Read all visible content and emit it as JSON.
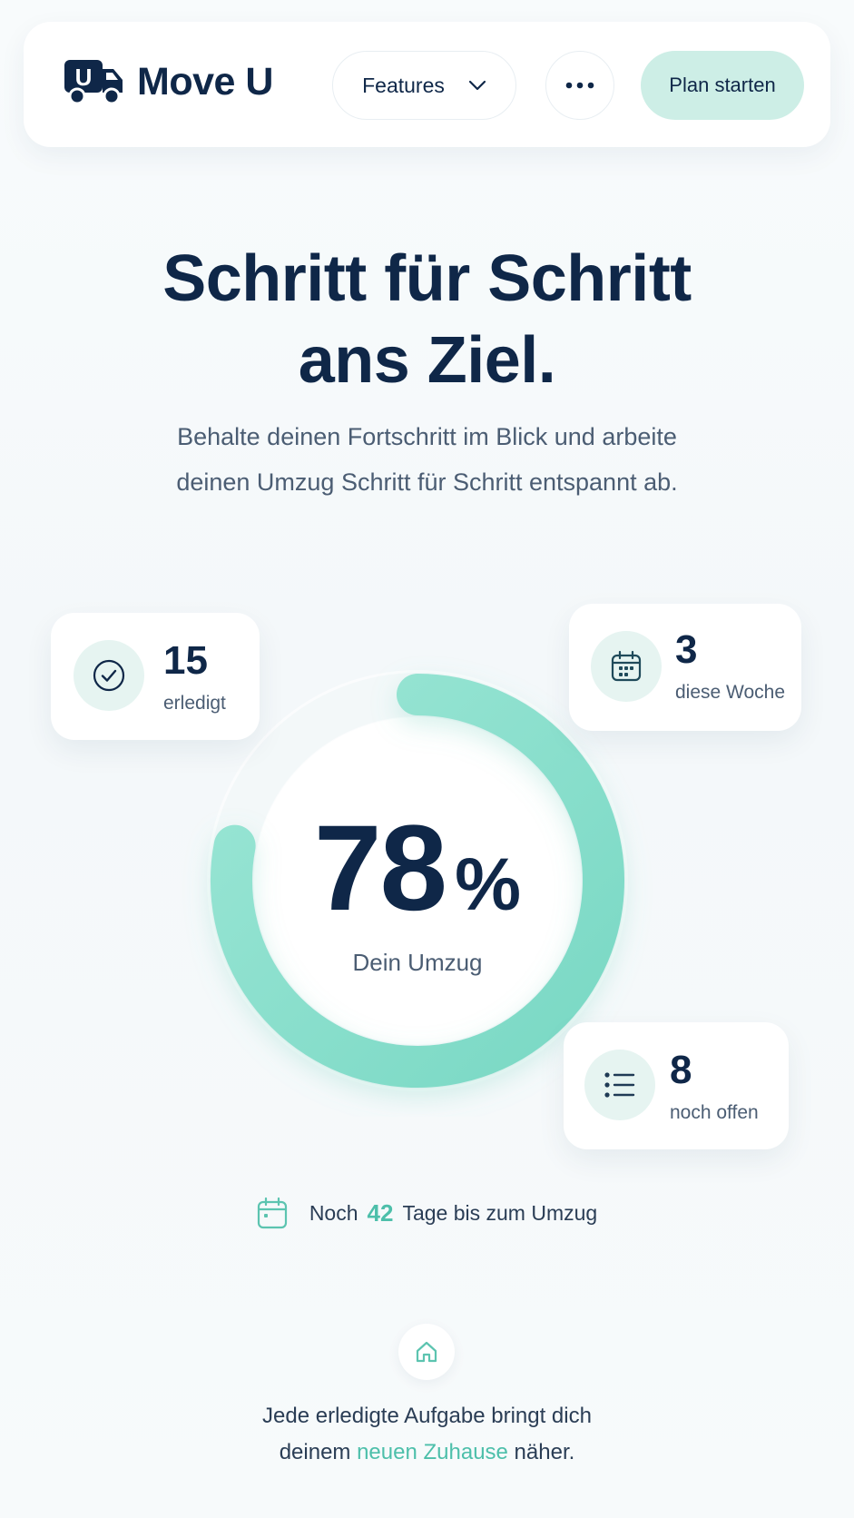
{
  "header": {
    "brand": "Move U",
    "logo_letter": "U",
    "features_label": "Features",
    "plan_label": "Plan starten"
  },
  "hero": {
    "title_line1": "Schritt für Schritt",
    "title_line2": "ans Ziel.",
    "subtitle_line1": "Behalte deinen Fortschritt im Blick und arbeite",
    "subtitle_line2": "deinen Umzug Schritt für Schritt entspannt ab."
  },
  "progress": {
    "percent_value": "78",
    "percent_symbol": "%",
    "fraction": 0.78,
    "label": "Dein Umzug",
    "accent": "#7fdcc8",
    "track": "#ffffff"
  },
  "stats": {
    "done": {
      "value": "15",
      "label": "erledigt",
      "icon": "check-circle-icon"
    },
    "week": {
      "value": "3",
      "label": "diese Woche",
      "icon": "calendar-icon"
    },
    "open": {
      "value": "8",
      "label": "noch offen",
      "icon": "list-icon"
    }
  },
  "countdown": {
    "prefix": "Noch",
    "days": "42",
    "suffix": "Tage bis zum Umzug"
  },
  "footer": {
    "line1": "Jede erledigte Aufgabe bringt dich",
    "line2_prefix": "deinem ",
    "line2_accent": "neuen Zuhause",
    "line2_suffix": " näher."
  },
  "colors": {
    "navy": "#0f2748",
    "teal": "#4dbfaa",
    "mint": "#cdeee6"
  }
}
